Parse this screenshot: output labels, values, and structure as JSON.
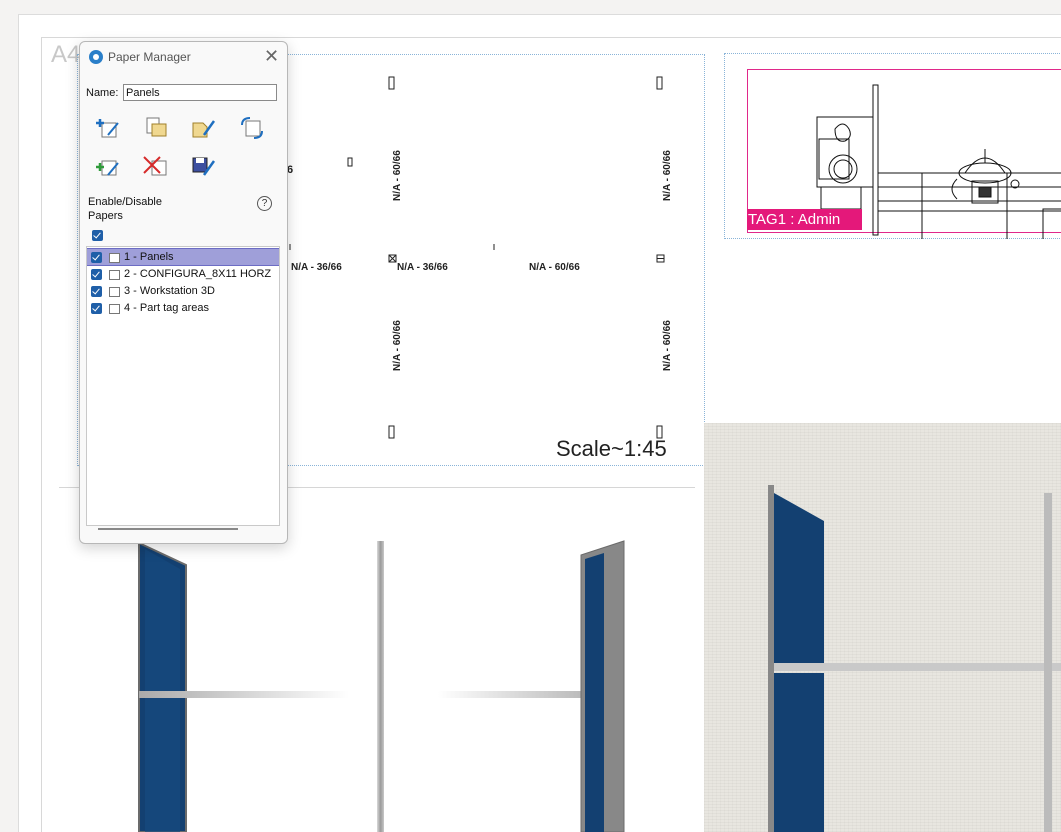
{
  "sheet": {
    "label": "A4",
    "scale": "Scale~1:45"
  },
  "drawing": {
    "dims_horizontal": [
      "N/A - 36/66",
      "N/A - 36/66",
      "N/A - 60/66"
    ],
    "dims_vertical": [
      "N/A - 60/66",
      "N/A - 60/66",
      "N/A - 60/66",
      "N/A - 60/66"
    ],
    "marker_6": "6"
  },
  "tag": {
    "label": "TAG1 : Admin"
  },
  "dialog": {
    "title": "Paper Manager",
    "close_glyph": "✕",
    "name_label": "Name:",
    "name_value": "Panels",
    "toolbar": [
      "add-paper-icon",
      "copy-paper-icon",
      "edit-paper-icon",
      "refresh-paper-icon",
      "add-green-paper-icon",
      "delete-paper-icon",
      "save-paper-icon"
    ],
    "enable_label": "Enable/Disable Papers",
    "help_glyph": "?",
    "papers": [
      {
        "label": "1 - Panels",
        "checked": true,
        "selected": true
      },
      {
        "label": "2 - CONFIGURA_8X11 HORZ",
        "checked": true,
        "selected": false
      },
      {
        "label": "3 - Workstation 3D",
        "checked": true,
        "selected": false
      },
      {
        "label": "4 - Part tag areas",
        "checked": true,
        "selected": false
      }
    ]
  },
  "colors": {
    "accent": "#1f5fa8",
    "tag": "#e4187a",
    "selection": "#9f9fd9",
    "panel_fabric": "#123f6e"
  }
}
